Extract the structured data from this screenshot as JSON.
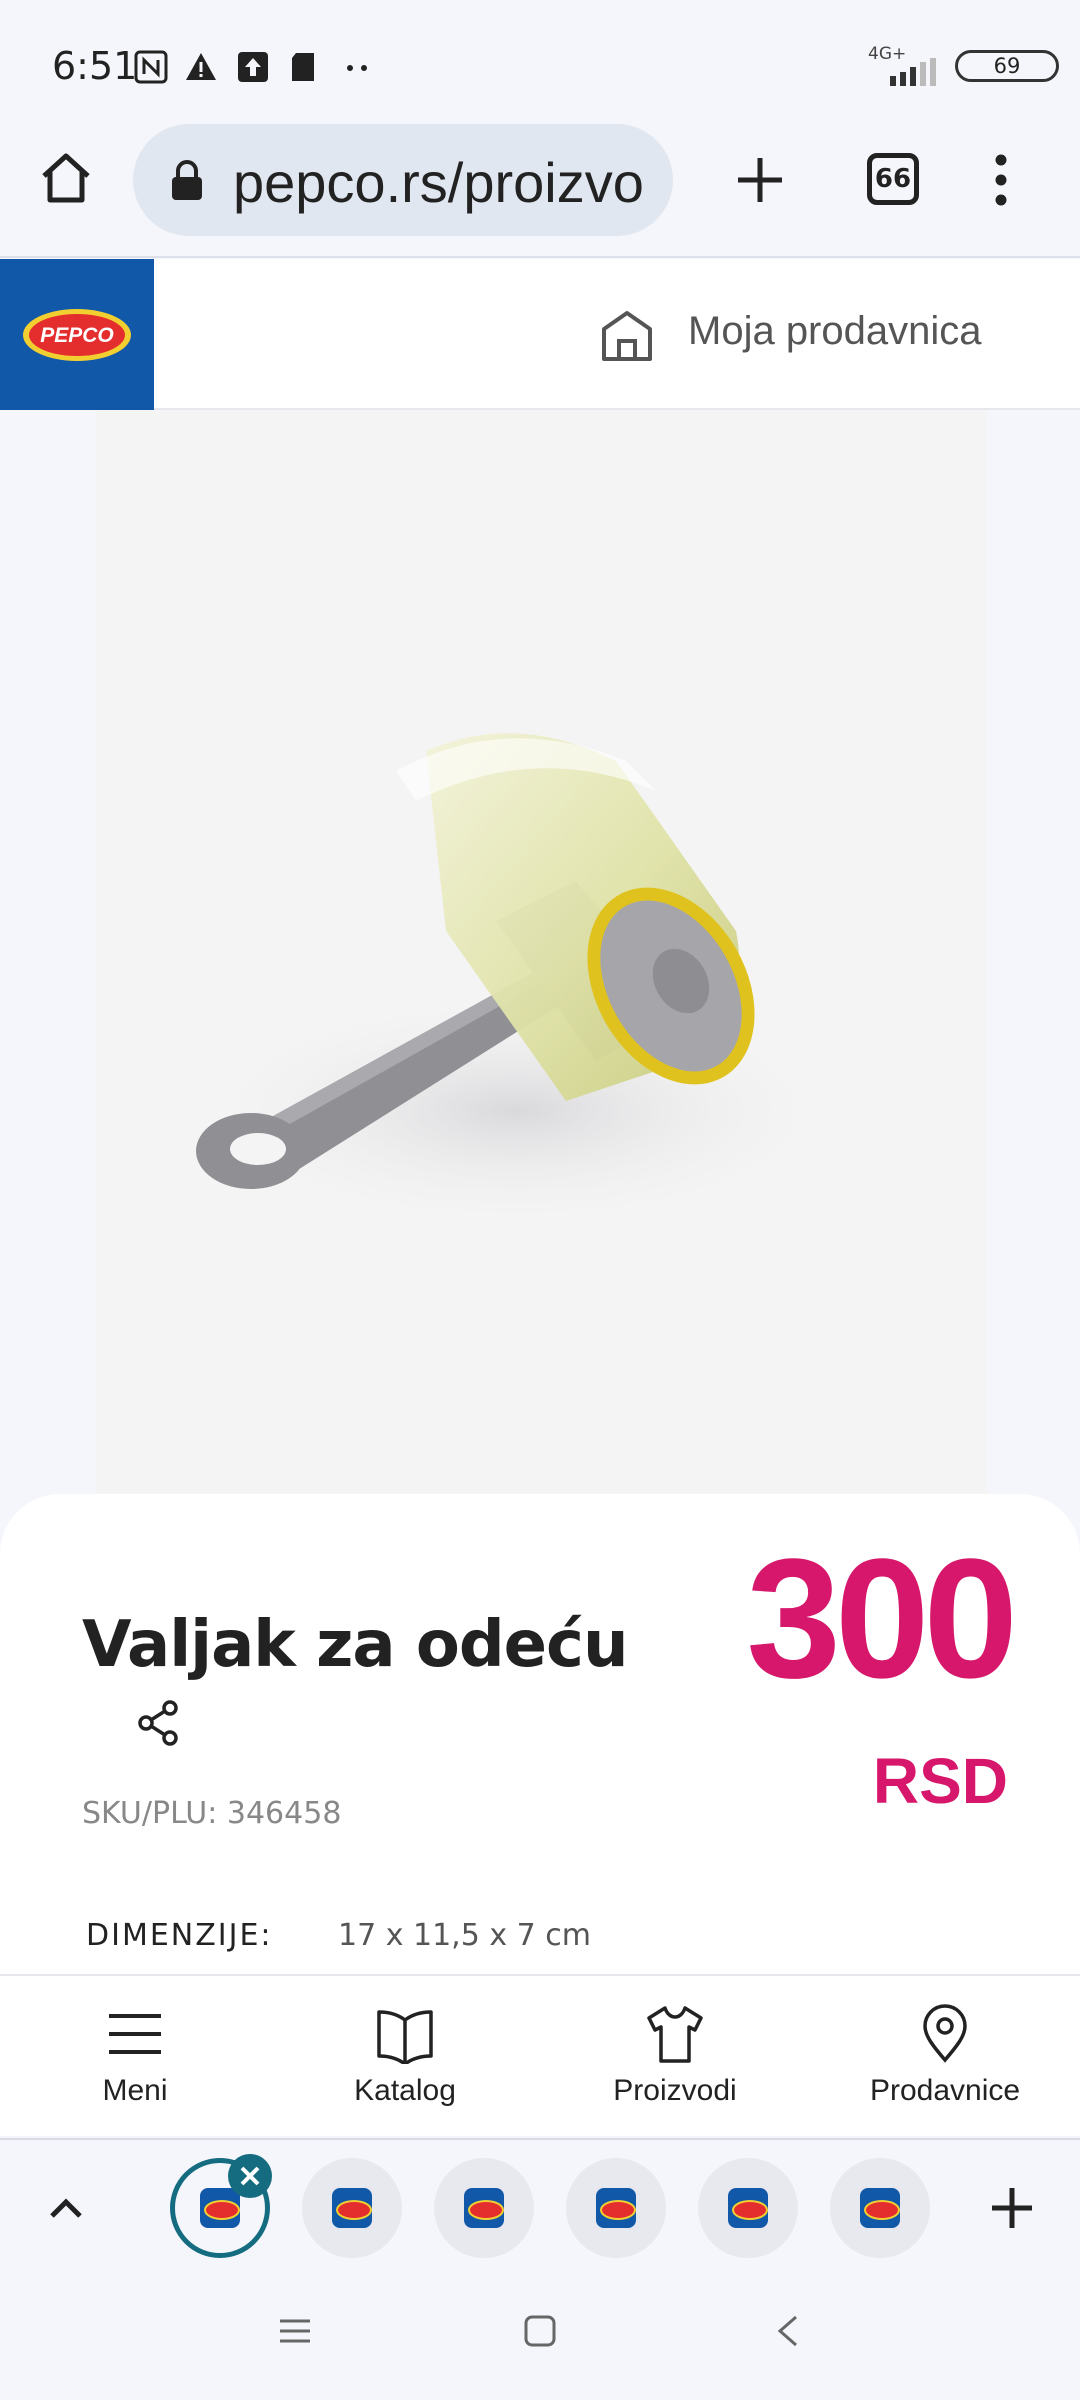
{
  "status_bar": {
    "time": "6:51",
    "network": "4G+",
    "battery": "69",
    "icons": [
      "nfc-icon",
      "alert-icon",
      "upload-icon",
      "sd-card-icon",
      "more-dots-icon"
    ]
  },
  "browser": {
    "url": "pepco.rs/proizvo",
    "tab_count": "66"
  },
  "site_header": {
    "logo_text": "PEPCO",
    "store_label": "Moja prodavnica"
  },
  "product": {
    "title": "Valjak za odeću",
    "price_amount": "300",
    "price_currency": "RSD",
    "sku": "SKU/PLU: 346458",
    "dimensions_label": "DIMENZIJE:",
    "dimensions_value": "17 x 11,5 x 7 cm"
  },
  "site_nav": [
    {
      "label": "Meni",
      "icon": "menu-icon"
    },
    {
      "label": "Katalog",
      "icon": "book-icon"
    },
    {
      "label": "Proizvodi",
      "icon": "shirt-icon"
    },
    {
      "label": "Prodavnice",
      "icon": "location-pin-icon"
    }
  ],
  "colors": {
    "price": "#d6176b",
    "brand_blue": "#1258a8",
    "active_tab_ring": "#156c80"
  }
}
